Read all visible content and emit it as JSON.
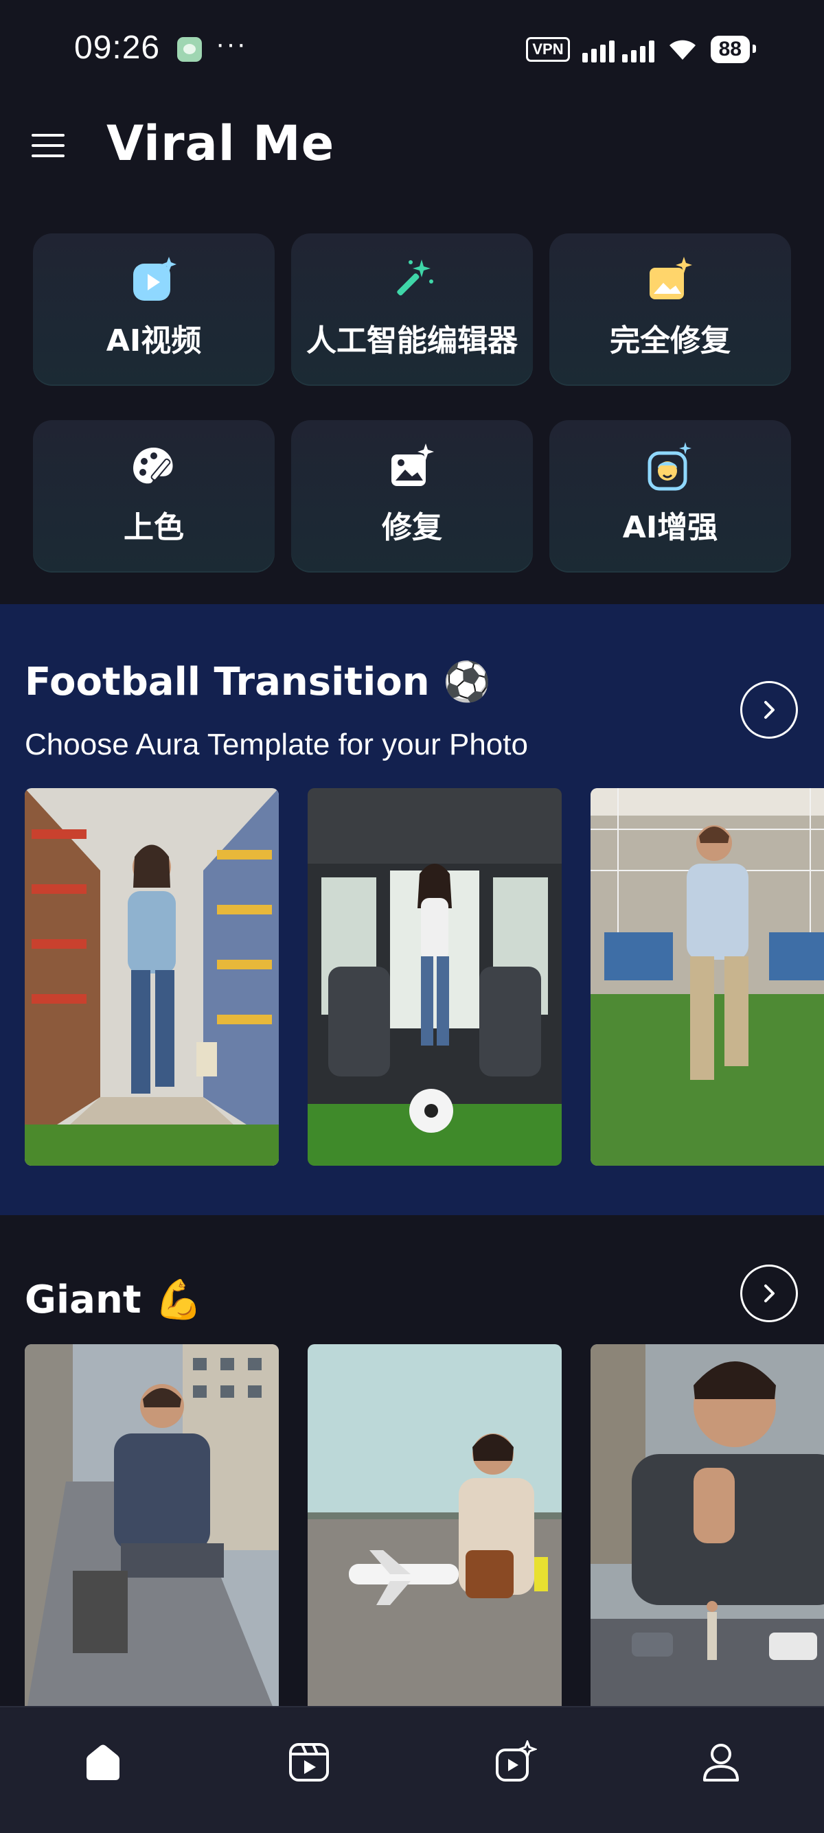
{
  "status_bar": {
    "time": "09:26",
    "dots": "···",
    "vpn": "VPN",
    "battery": "88"
  },
  "header": {
    "title": "Viral Me",
    "menu_icon": "hamburger-menu-icon"
  },
  "tools": [
    {
      "label": "AI视频",
      "icon": "ai-video-icon",
      "color": "#8fd8ff"
    },
    {
      "label": "人工智能编辑器",
      "icon": "magic-wand-icon",
      "color": "#3fd6a8"
    },
    {
      "label": "完全修复",
      "icon": "photo-sparkle-icon",
      "color": "#ffd56b"
    },
    {
      "label": "上色",
      "icon": "palette-icon",
      "color": "#ffffff"
    },
    {
      "label": "修复",
      "icon": "image-sparkle-icon",
      "color": "#ffffff"
    },
    {
      "label": "AI增强",
      "icon": "face-enhance-icon",
      "color": "#8fd8ff"
    }
  ],
  "sections": {
    "football": {
      "title": "Football Transition ⚽",
      "subtitle": "Choose Aura Template for your Photo",
      "arrow_icon": "chevron-right-icon",
      "templates": [
        "supermarket-woman-running",
        "bus-girl-with-ball",
        "office-man-running"
      ]
    },
    "giant": {
      "title": "Giant 💪",
      "arrow_icon": "chevron-right-icon",
      "templates": [
        "giant-man-city-street",
        "giant-woman-airport",
        "giant-man-road"
      ]
    }
  },
  "bottom_nav": [
    {
      "icon": "home-icon",
      "active": true
    },
    {
      "icon": "video-play-icon",
      "active": false
    },
    {
      "icon": "ai-video-icon",
      "active": false
    },
    {
      "icon": "profile-icon",
      "active": false
    }
  ],
  "colors": {
    "background": "#14151f",
    "section_blue": "#13214f",
    "card": "#202433",
    "nav": "#1e202e"
  }
}
